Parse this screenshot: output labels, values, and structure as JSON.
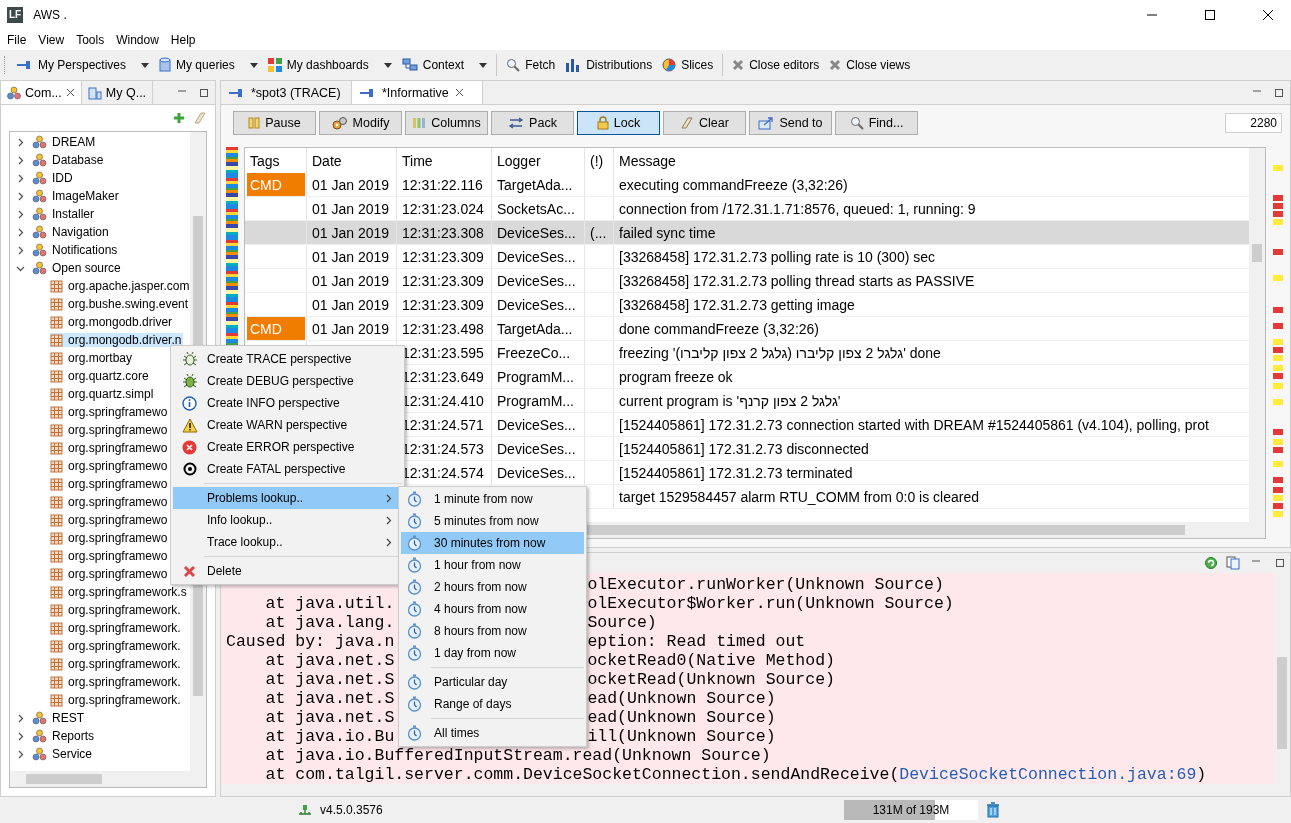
{
  "window": {
    "logo": "LF",
    "title": "AWS ."
  },
  "menu_bar": [
    "File",
    "View",
    "Tools",
    "Window",
    "Help"
  ],
  "toolbar": [
    [
      {
        "label": "My Perspectives",
        "dropdown": true
      },
      {
        "label": "My queries",
        "dropdown": true
      },
      {
        "label": "My dashboards",
        "dropdown": true
      },
      {
        "label": "Context",
        "dropdown": true
      }
    ],
    [
      {
        "label": "Fetch",
        "dropdown": false
      },
      {
        "label": "Distributions",
        "dropdown": false
      },
      {
        "label": "Slices",
        "dropdown": false
      }
    ],
    [
      {
        "label": "Close editors",
        "dropdown": false
      },
      {
        "label": "Close views",
        "dropdown": false
      }
    ]
  ],
  "left_panel": {
    "tabs": [
      {
        "label": "Com...",
        "selected": true
      },
      {
        "label": "My Q...",
        "selected": false
      }
    ],
    "tree": [
      {
        "label": "DREAM",
        "expanded": false,
        "selected": false
      },
      {
        "label": "Database",
        "expanded": false,
        "selected": false
      },
      {
        "label": "IDD",
        "expanded": false,
        "selected": false
      },
      {
        "label": "ImageMaker",
        "expanded": false,
        "selected": false
      },
      {
        "label": "Installer",
        "expanded": false,
        "selected": false
      },
      {
        "label": "Navigation",
        "expanded": false,
        "selected": false
      },
      {
        "label": "Notifications",
        "expanded": false,
        "selected": false
      },
      {
        "label": "Open source",
        "expanded": true,
        "selected": false,
        "children": [
          {
            "label": "org.apache.jasper.com",
            "selected": false
          },
          {
            "label": "org.bushe.swing.event",
            "selected": false
          },
          {
            "label": "org.mongodb.driver",
            "selected": false
          },
          {
            "label": "org.mongodb.driver.n",
            "selected": true
          },
          {
            "label": "org.mortbay",
            "selected": false
          },
          {
            "label": "org.quartz.core",
            "selected": false
          },
          {
            "label": "org.quartz.simpl",
            "selected": false
          },
          {
            "label": "org.springframewo",
            "selected": false
          },
          {
            "label": "org.springframewo",
            "selected": false
          },
          {
            "label": "org.springframewo",
            "selected": false
          },
          {
            "label": "org.springframewo",
            "selected": false
          },
          {
            "label": "org.springframewo",
            "selected": false
          },
          {
            "label": "org.springframewo",
            "selected": false
          },
          {
            "label": "org.springframewo",
            "selected": false
          },
          {
            "label": "org.springframewo",
            "selected": false
          },
          {
            "label": "org.springframewo",
            "selected": false
          },
          {
            "label": "org.springframewo",
            "selected": false
          },
          {
            "label": "org.springframework.s",
            "selected": false
          },
          {
            "label": "org.springframework.",
            "selected": false
          },
          {
            "label": "org.springframework.",
            "selected": false
          },
          {
            "label": "org.springframework.",
            "selected": false
          },
          {
            "label": "org.springframework.",
            "selected": false
          },
          {
            "label": "org.springframework.",
            "selected": false
          },
          {
            "label": "org.springframework.",
            "selected": false
          }
        ]
      },
      {
        "label": "REST",
        "expanded": false,
        "selected": false
      },
      {
        "label": "Reports",
        "expanded": false,
        "selected": false
      },
      {
        "label": "Service",
        "expanded": false,
        "selected": false
      }
    ]
  },
  "editor_tabs": [
    {
      "label": "*spot3 (TRACE)",
      "selected": false
    },
    {
      "label": "*Informative",
      "selected": true
    }
  ],
  "log_toolbar": {
    "buttons": [
      {
        "label": "Pause",
        "pressed": false
      },
      {
        "label": "Modify",
        "pressed": false
      },
      {
        "label": "Columns",
        "pressed": false
      },
      {
        "label": "Pack",
        "pressed": false
      },
      {
        "label": "Lock",
        "pressed": true
      },
      {
        "label": "Clear",
        "pressed": false
      },
      {
        "label": "Send to",
        "pressed": false
      },
      {
        "label": "Find...",
        "pressed": false
      }
    ],
    "count": "2280"
  },
  "table": {
    "columns": [
      "Tags",
      "Date",
      "Time",
      "Logger",
      "(!)",
      "Message"
    ],
    "rows": [
      {
        "tag": "CMD",
        "date": "01 Jan 2019",
        "time": "12:31:22.116",
        "logger": "TargetAda...",
        "message": "executing commandFreeze (3,32:26)",
        "selected": false
      },
      {
        "date": "01 Jan 2019",
        "time": "12:31:23.024",
        "logger": "SocketsAc...",
        "message": "connection from /172.31.1.71:8576, queued: 1, running: 9",
        "selected": false
      },
      {
        "date": "01 Jan 2019",
        "time": "12:31:23.308",
        "logger": "DeviceSes...",
        "flag": "(...",
        "message": "failed sync time",
        "selected": true
      },
      {
        "date": "01 Jan 2019",
        "time": "12:31:23.309",
        "logger": "DeviceSes...",
        "message": "[33268458] 172.31.2.73  polling rate is 10 (300) sec",
        "selected": false
      },
      {
        "date": "01 Jan 2019",
        "time": "12:31:23.309",
        "logger": "DeviceSes...",
        "message": "[33268458] 172.31.2.73  polling thread starts as PASSIVE",
        "selected": false
      },
      {
        "date": "01 Jan 2019",
        "time": "12:31:23.309",
        "logger": "DeviceSes...",
        "message": "[33268458] 172.31.2.73 getting image",
        "selected": false
      },
      {
        "tag": "CMD",
        "date": "01 Jan 2019",
        "time": "12:31:23.498",
        "logger": "TargetAda...",
        "message": "done commandFreeze (3,32:26)",
        "selected": false
      },
      {
        "time": "12:31:23.595",
        "logger": "FreezeCo...",
        "message": "freezing 'גלגל 2 צפון קליברו (גלגל 2 צפון קליברו)' done",
        "selected": false
      },
      {
        "time": "12:31:23.649",
        "logger": "ProgramM...",
        "message": "program freeze ok",
        "selected": false
      },
      {
        "time": "12:31:24.410",
        "logger": "ProgramM...",
        "message": "current program is 'גלגל 2 צפון קרנף'",
        "selected": false
      },
      {
        "time": "12:31:24.571",
        "logger": "DeviceSes...",
        "message": "[1524405861] 172.31.2.73  connection started with DREAM #1524405861 (v4.104), polling, prot",
        "selected": false
      },
      {
        "time": "12:31:24.573",
        "logger": "DeviceSes...",
        "message": "[1524405861] 172.31.2.73 disconnected",
        "selected": false
      },
      {
        "time": "12:31:24.574",
        "logger": "DeviceSes...",
        "message": "[1524405861] 172.31.2.73  terminated",
        "selected": false
      },
      {
        "message": "target 1529584457 alarm RTU_COMM from 0:0 is cleared",
        "selected": false
      }
    ]
  },
  "console": {
    "lines": [
      {
        "right": "olExecutor.runWorker(Unknown Source)"
      },
      {
        "indented": true,
        "left": "at java.util.",
        "right": "olExecutor$Worker.run(Unknown Source)"
      },
      {
        "indented": true,
        "left": "at java.lang.",
        "right": "Source)"
      },
      {
        "indented": false,
        "left": "Caused by: java.n",
        "right": "eption: Read timed out"
      },
      {
        "indented": true,
        "left": "at java.net.S",
        "right": "ocketRead0(Native Method)"
      },
      {
        "indented": true,
        "left": "at java.net.S",
        "right": "ocketRead(Unknown Source)"
      },
      {
        "indented": true,
        "left": "at java.net.S",
        "right": "ead(Unknown Source)"
      },
      {
        "indented": true,
        "left": "at java.net.S",
        "right": "ead(Unknown Source)"
      },
      {
        "indented": true,
        "left": "at java.io.Bu",
        "right": "ill(Unknown Source)"
      },
      {
        "indented": true,
        "text": "at java.io.BufferedInputStream.read(Unknown Source)"
      },
      {
        "indented": true,
        "text": "at com.talgil.server.comm.DeviceSocketConnection.sendAndReceive(",
        "link": "DeviceSocketConnection.java:69",
        "tail": ")"
      }
    ]
  },
  "context_menu": [
    {
      "kind": "item",
      "label": "Create TRACE perspective",
      "submenu": false,
      "selected": false
    },
    {
      "kind": "item",
      "label": "Create DEBUG perspective",
      "submenu": false,
      "selected": false
    },
    {
      "kind": "item",
      "label": "Create INFO perspective",
      "submenu": false,
      "selected": false
    },
    {
      "kind": "item",
      "label": "Create WARN perspective",
      "submenu": false,
      "selected": false
    },
    {
      "kind": "item",
      "label": "Create ERROR perspective",
      "submenu": false,
      "selected": false
    },
    {
      "kind": "item",
      "label": "Create FATAL perspective",
      "submenu": false,
      "selected": false
    },
    {
      "kind": "separator"
    },
    {
      "kind": "item",
      "label": "Problems lookup..",
      "submenu": true,
      "selected": true
    },
    {
      "kind": "item",
      "label": "Info lookup..",
      "submenu": true,
      "selected": false
    },
    {
      "kind": "item",
      "label": "Trace lookup..",
      "submenu": true,
      "selected": false
    },
    {
      "kind": "separator"
    },
    {
      "kind": "item",
      "label": "Delete",
      "submenu": false,
      "selected": false
    }
  ],
  "submenu": [
    {
      "kind": "item",
      "label": "1 minute from now",
      "selected": false
    },
    {
      "kind": "item",
      "label": "5 minutes from now",
      "selected": false
    },
    {
      "kind": "item",
      "label": "30 minutes from now",
      "selected": true
    },
    {
      "kind": "item",
      "label": "1 hour from now",
      "selected": false
    },
    {
      "kind": "item",
      "label": "2 hours from now",
      "selected": false
    },
    {
      "kind": "item",
      "label": "4 hours from now",
      "selected": false
    },
    {
      "kind": "item",
      "label": "8 hours from now",
      "selected": false
    },
    {
      "kind": "item",
      "label": "1 day from now",
      "selected": false
    },
    {
      "kind": "separator"
    },
    {
      "kind": "item",
      "label": "Particular day",
      "selected": false
    },
    {
      "kind": "item",
      "label": "Range of days",
      "selected": false
    },
    {
      "kind": "separator"
    },
    {
      "kind": "item",
      "label": "All times",
      "selected": false
    }
  ],
  "status_bar": {
    "version": "v4.5.0.3576",
    "memory": {
      "text": "131M of 193M",
      "level": 0.68
    }
  }
}
